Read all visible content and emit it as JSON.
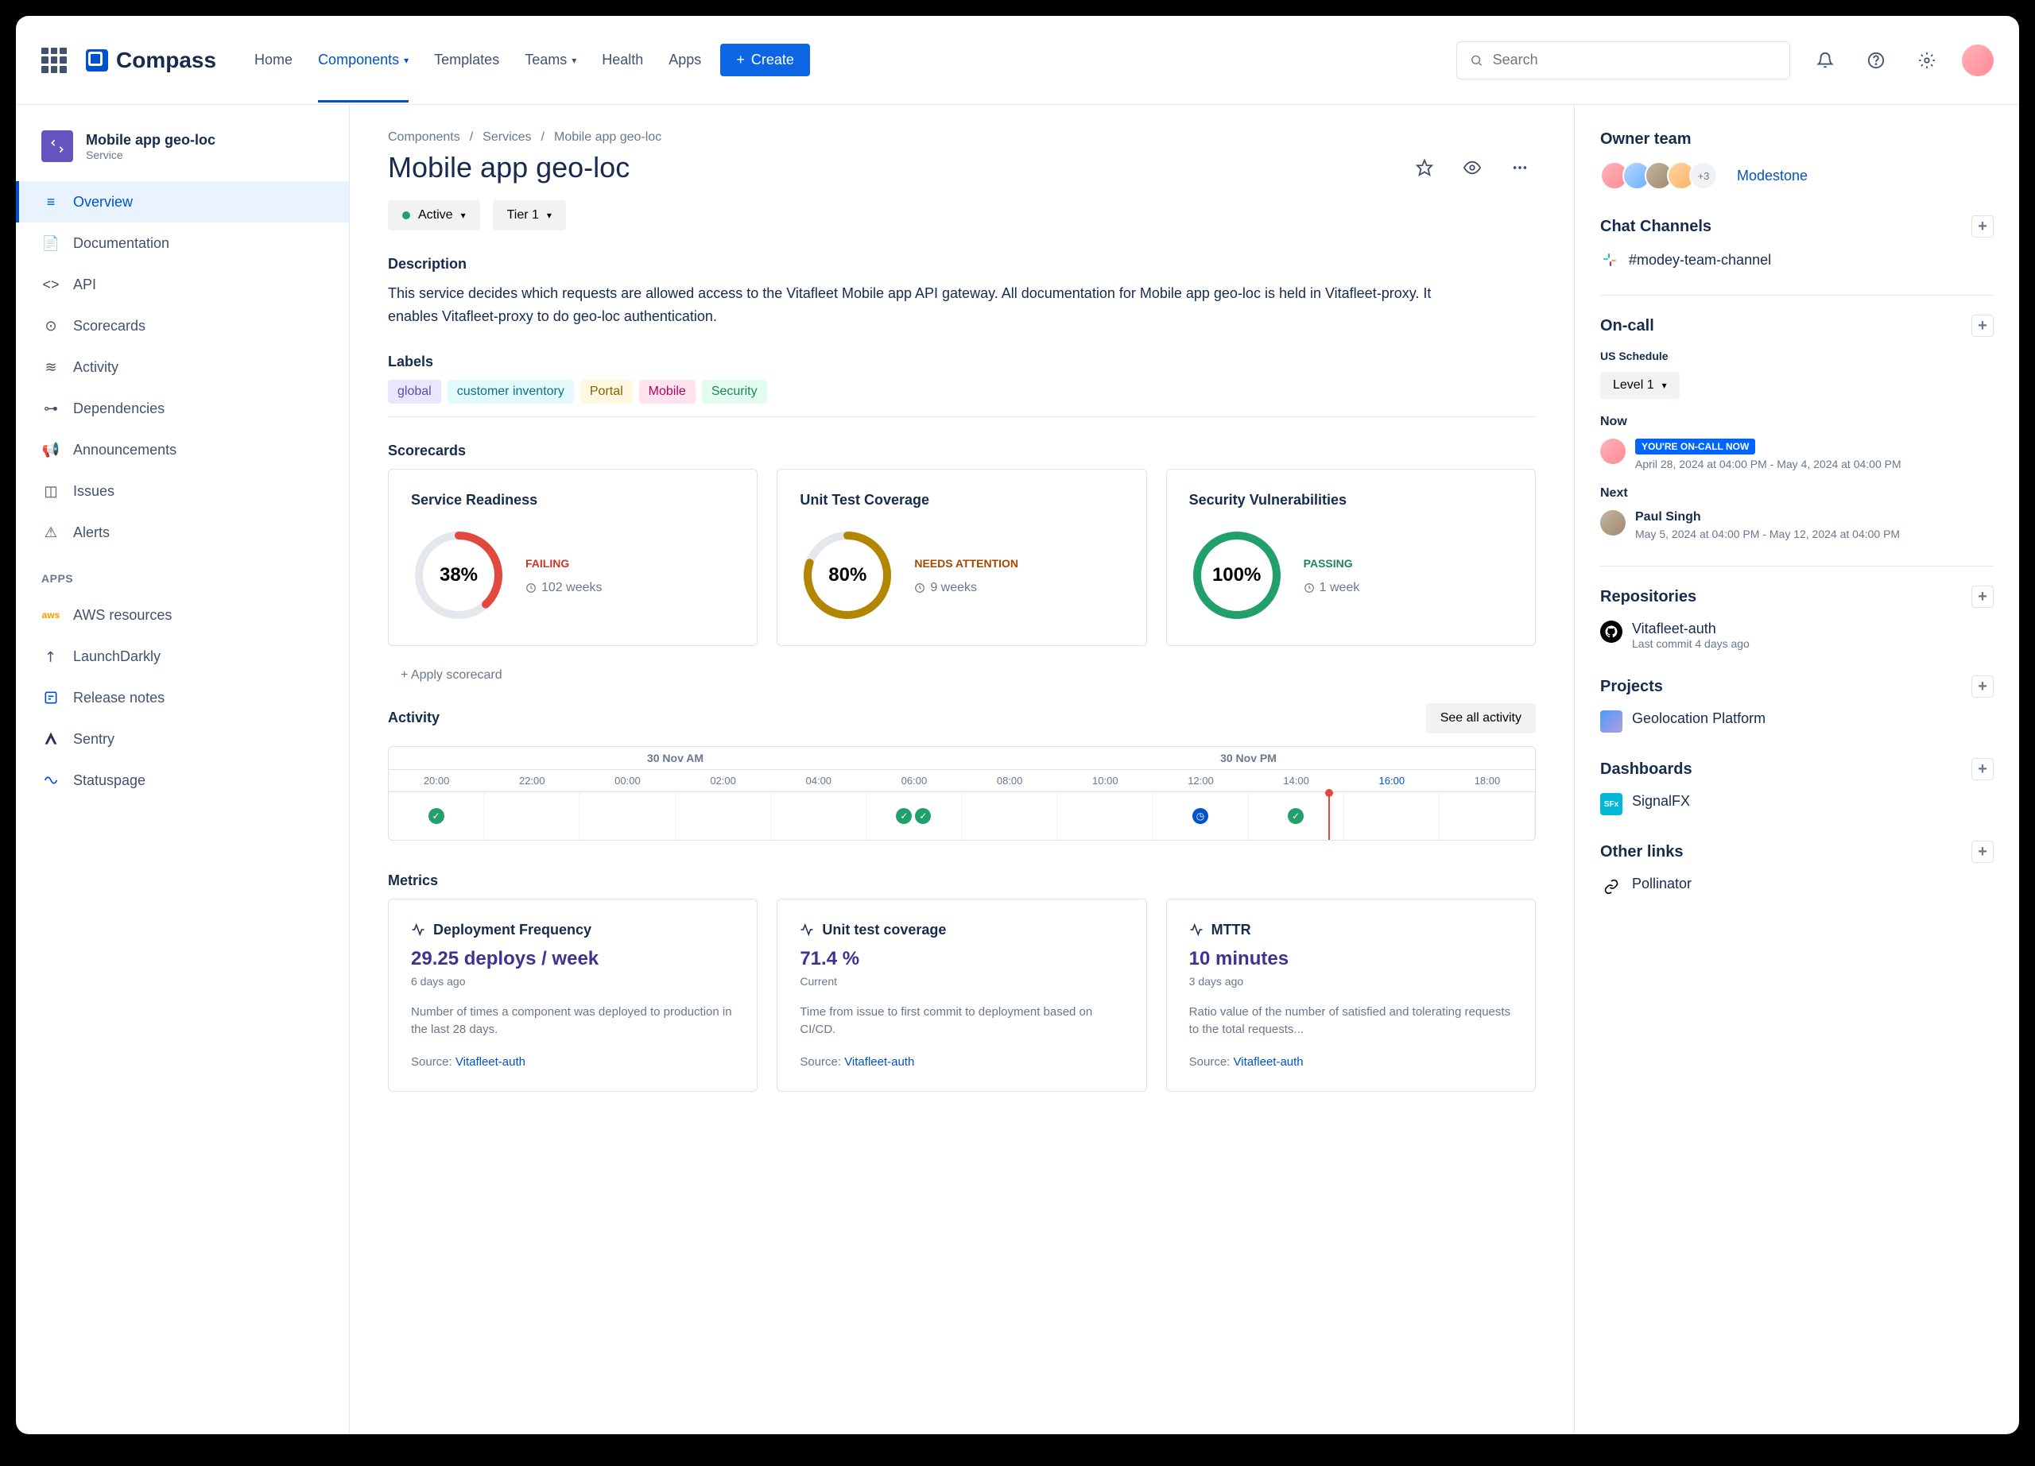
{
  "nav": {
    "product": "Compass",
    "items": [
      "Home",
      "Components",
      "Templates",
      "Teams",
      "Health",
      "Apps"
    ],
    "active_index": 1,
    "has_dropdown": [
      false,
      true,
      false,
      true,
      false,
      false
    ],
    "create_label": "Create",
    "search_placeholder": "Search"
  },
  "sidebar": {
    "component_name": "Mobile app geo-loc",
    "component_type": "Service",
    "items": [
      "Overview",
      "Documentation",
      "API",
      "Scorecards",
      "Activity",
      "Dependencies",
      "Announcements",
      "Issues",
      "Alerts"
    ],
    "active_index": 0,
    "apps_label": "APPS",
    "apps": [
      "AWS resources",
      "LaunchDarkly",
      "Release notes",
      "Sentry",
      "Statuspage"
    ]
  },
  "breadcrumb": [
    "Components",
    "Services",
    "Mobile app geo-loc"
  ],
  "page_title": "Mobile app geo-loc",
  "status": {
    "state": "Active",
    "tier": "Tier 1"
  },
  "description_h": "Description",
  "description": "This service decides which requests are allowed access to the Vitafleet Mobile app API gateway. All documentation for Mobile app geo-loc is held in Vitafleet-proxy. It enables Vitafleet-proxy to do geo-loc authentication.",
  "labels_h": "Labels",
  "labels": [
    {
      "text": "global",
      "cls": "purple"
    },
    {
      "text": "customer inventory",
      "cls": "teal"
    },
    {
      "text": "Portal",
      "cls": "yellow"
    },
    {
      "text": "Mobile",
      "cls": "pink"
    },
    {
      "text": "Security",
      "cls": "green"
    }
  ],
  "scorecards_h": "Scorecards",
  "chart_data": [
    {
      "type": "pie",
      "title": "Service Readiness",
      "value": 38,
      "value_label": "38%",
      "status": "FAILING",
      "status_cls": "fail",
      "time": "102 weeks",
      "color": "#e2483d"
    },
    {
      "type": "pie",
      "title": "Unit Test Coverage",
      "value": 80,
      "value_label": "80%",
      "status": "NEEDS ATTENTION",
      "status_cls": "warn",
      "time": "9 weeks",
      "color": "#b38600"
    },
    {
      "type": "pie",
      "title": "Security Vulnerabilities",
      "value": 100,
      "value_label": "100%",
      "status": "PASSING",
      "status_cls": "pass",
      "time": "1 week",
      "color": "#22a06b"
    }
  ],
  "apply_scorecard": "Apply scorecard",
  "activity_h": "Activity",
  "see_all": "See all activity",
  "timeline": {
    "halves": [
      "30 Nov AM",
      "30 Nov PM"
    ],
    "times": [
      "20:00",
      "22:00",
      "00:00",
      "02:00",
      "04:00",
      "06:00",
      "08:00",
      "10:00",
      "12:00",
      "14:00",
      "16:00",
      "18:00"
    ],
    "current_idx": 10,
    "events": [
      {
        "slot": 0,
        "type": "ok"
      },
      {
        "slot": 5,
        "type": "ok"
      },
      {
        "slot": 5,
        "type": "ok"
      },
      {
        "slot": 8,
        "type": "clock"
      },
      {
        "slot": 9,
        "type": "ok"
      }
    ],
    "marker_pct": 82
  },
  "metrics_h": "Metrics",
  "metrics": [
    {
      "title": "Deployment Frequency",
      "value": "29.25 deploys / week",
      "time": "6 days ago",
      "desc": "Number of times a component was deployed to production in the last 28 days.",
      "source": "Vitafleet-auth"
    },
    {
      "title": "Unit test coverage",
      "value": "71.4 %",
      "time": "Current",
      "desc": "Time from issue to first commit to deployment based on CI/CD.",
      "source": "Vitafleet-auth"
    },
    {
      "title": "MTTR",
      "value": "10 minutes",
      "time": "3 days ago",
      "desc": "Ratio value of the number of satisfied and tolerating requests to the total requests...",
      "source": "Vitafleet-auth"
    }
  ],
  "source_label": "Source: ",
  "right": {
    "owner_h": "Owner team",
    "team_more": "+3",
    "team_name": "Modestone",
    "chat_h": "Chat Channels",
    "chat_channel": "#modey-team-channel",
    "oncall_h": "On-call",
    "schedule": "US Schedule",
    "level": "Level 1",
    "now_label": "Now",
    "oncall_badge": "YOU'RE ON-CALL NOW",
    "now_time": "April 28, 2024 at 04:00 PM - May 4, 2024 at 04:00 PM",
    "next_label": "Next",
    "next_name": "Paul Singh",
    "next_time": "May 5, 2024 at 04:00 PM - May 12, 2024 at 04:00 PM",
    "repos_h": "Repositories",
    "repo_name": "Vitafleet-auth",
    "repo_sub": "Last commit 4 days ago",
    "projects_h": "Projects",
    "project_name": "Geolocation Platform",
    "dash_h": "Dashboards",
    "dash_name": "SignalFX",
    "links_h": "Other links",
    "link_name": "Pollinator"
  }
}
